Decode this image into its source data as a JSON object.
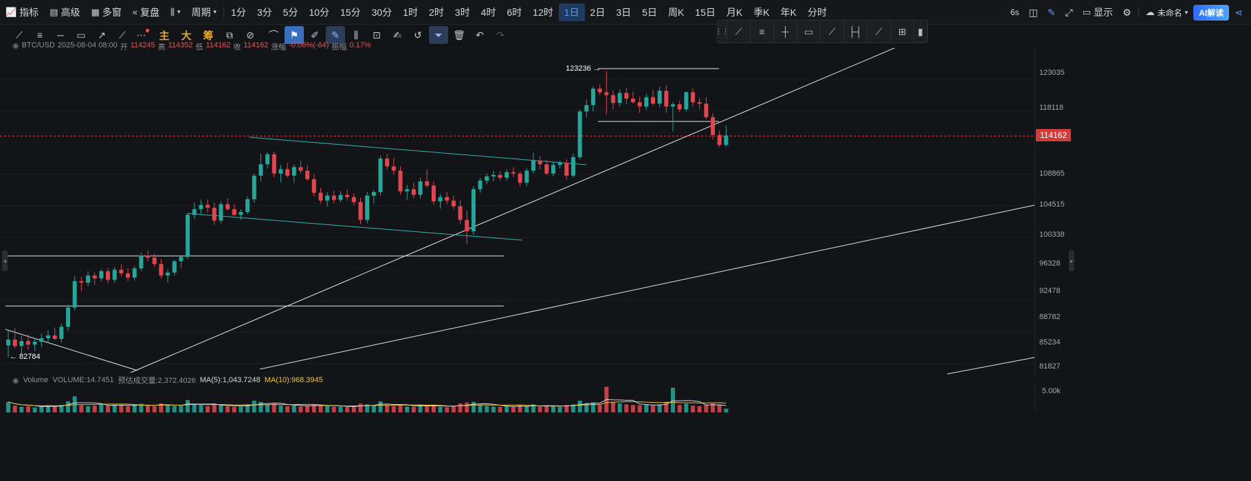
{
  "topbar": {
    "left_items": [
      {
        "name": "indicator-button",
        "icon": "chart-icon",
        "label": "指标"
      },
      {
        "name": "advanced-button",
        "icon": "calendar-icon",
        "label": "高级"
      },
      {
        "name": "multiwindow-button",
        "icon": "grid-icon",
        "label": "多窗"
      },
      {
        "name": "replay-button",
        "icon": "rewind-icon",
        "label": "复盘"
      },
      {
        "name": "chart-type-button",
        "icon": "candle-icon",
        "label": ""
      },
      {
        "name": "period-dropdown",
        "icon": "chevron-down-icon",
        "label": "周期"
      }
    ],
    "periods": [
      "1分",
      "3分",
      "5分",
      "10分",
      "15分",
      "30分",
      "1时",
      "2时",
      "3时",
      "4时",
      "6时",
      "12时",
      "1日",
      "2日",
      "3日",
      "5日",
      "周K",
      "15日",
      "月K",
      "季K",
      "年K",
      "分时"
    ],
    "active_period": "1日",
    "right": {
      "refresh": "6s",
      "display_label": "显示",
      "layout_name": "未命名",
      "ai_label": "AI解读"
    }
  },
  "drawing_tools": {
    "text_tools": [
      "主",
      "大",
      "筹"
    ]
  },
  "info": {
    "symbol": "BTC/USD",
    "datetime": "2025-08-04 08:00",
    "open_label": "开",
    "open": "114245",
    "high_label": "高",
    "high": "114352",
    "low_label": "低",
    "low": "114162",
    "close_label": "收",
    "close": "114162",
    "change_label": "涨幅",
    "change": "-0.06%(-64)",
    "amp_label": "振幅",
    "amp": "0.17%"
  },
  "price_axis": {
    "ticks": [
      "123035",
      "118118",
      "108865",
      "104515",
      "100338",
      "96328",
      "92478",
      "88782",
      "85234",
      "81827"
    ],
    "last_price": "114162"
  },
  "annotations": {
    "high_label": "123236",
    "low_label": "82784"
  },
  "volume": {
    "title": "Volume",
    "volume": "VOLUME:14.7451",
    "estimated": "预估成交量:2,372.4026",
    "ma5": "MA(5):1,043.7248",
    "ma10": "MA(10):968.3945",
    "axis_label": "5.00k"
  },
  "colors": {
    "up": "#26a69a",
    "down": "#e0464e",
    "accent": "#4c9cff",
    "channel": "#2fb7b7"
  },
  "chart_data": {
    "type": "candlestick",
    "title": "BTC/USD",
    "interval": "1日",
    "ylim": [
      80500,
      126500
    ],
    "candles": [
      [
        84800,
        86900,
        83100,
        85600
      ],
      [
        85600,
        87200,
        84400,
        84700
      ],
      [
        84700,
        86100,
        83600,
        85400
      ],
      [
        85400,
        86300,
        84200,
        84900
      ],
      [
        84900,
        85800,
        84000,
        85300
      ],
      [
        85300,
        86400,
        84600,
        85800
      ],
      [
        85800,
        86900,
        85100,
        86200
      ],
      [
        86200,
        87300,
        85500,
        85700
      ],
      [
        85700,
        87900,
        85200,
        87400
      ],
      [
        87400,
        90500,
        86800,
        90100
      ],
      [
        90100,
        94500,
        89700,
        93800
      ],
      [
        93800,
        94400,
        92400,
        93600
      ],
      [
        93600,
        95200,
        93100,
        94600
      ],
      [
        94600,
        95000,
        93300,
        94200
      ],
      [
        94200,
        95500,
        93800,
        95200
      ],
      [
        95200,
        95600,
        93500,
        94000
      ],
      [
        94000,
        95800,
        93600,
        95400
      ],
      [
        95400,
        96200,
        94500,
        94900
      ],
      [
        94900,
        95600,
        93800,
        94300
      ],
      [
        94300,
        95900,
        93900,
        95600
      ],
      [
        95600,
        97800,
        95200,
        97400
      ],
      [
        97400,
        98100,
        96600,
        97100
      ],
      [
        97100,
        97700,
        95800,
        96200
      ],
      [
        96200,
        96900,
        94200,
        94600
      ],
      [
        94600,
        95400,
        93600,
        95000
      ],
      [
        95000,
        96800,
        94600,
        96600
      ],
      [
        96600,
        97500,
        95700,
        97200
      ],
      [
        97200,
        103300,
        96900,
        103100
      ],
      [
        103100,
        104800,
        102500,
        103900
      ],
      [
        103900,
        105200,
        103300,
        104500
      ],
      [
        104500,
        105300,
        103400,
        104100
      ],
      [
        104100,
        104800,
        101700,
        102300
      ],
      [
        102300,
        105000,
        101900,
        104600
      ],
      [
        104600,
        105400,
        103700,
        103900
      ],
      [
        103900,
        104600,
        102900,
        103100
      ],
      [
        103100,
        103900,
        102400,
        103500
      ],
      [
        103500,
        105700,
        103200,
        105300
      ],
      [
        105300,
        108900,
        104800,
        108600
      ],
      [
        108600,
        111700,
        107800,
        110200
      ],
      [
        110200,
        111900,
        109600,
        111600
      ],
      [
        111600,
        112000,
        108400,
        108900
      ],
      [
        108900,
        110100,
        107700,
        109500
      ],
      [
        109500,
        110400,
        108300,
        108600
      ],
      [
        108600,
        110200,
        107600,
        109800
      ],
      [
        109800,
        110700,
        108900,
        109300
      ],
      [
        109300,
        110100,
        107900,
        108100
      ],
      [
        108100,
        108800,
        105700,
        106200
      ],
      [
        106200,
        106900,
        104700,
        105100
      ],
      [
        105100,
        106300,
        104300,
        105800
      ],
      [
        105800,
        106500,
        104700,
        105200
      ],
      [
        105200,
        106400,
        104900,
        105900
      ],
      [
        105900,
        106700,
        105100,
        105600
      ],
      [
        105600,
        106100,
        104400,
        104900
      ],
      [
        104900,
        105500,
        101800,
        102400
      ],
      [
        102400,
        106300,
        101900,
        105800
      ],
      [
        105800,
        106600,
        104700,
        106300
      ],
      [
        106300,
        111400,
        105800,
        111000
      ],
      [
        111000,
        111700,
        109400,
        109900
      ],
      [
        109900,
        111100,
        108700,
        109300
      ],
      [
        109300,
        109900,
        105900,
        106400
      ],
      [
        106400,
        107300,
        105200,
        106700
      ],
      [
        106700,
        107600,
        105400,
        105900
      ],
      [
        105900,
        108300,
        105400,
        107800
      ],
      [
        107800,
        109500,
        106900,
        107200
      ],
      [
        107200,
        107800,
        104500,
        105000
      ],
      [
        105000,
        106000,
        104000,
        105600
      ],
      [
        105600,
        106300,
        104600,
        105100
      ],
      [
        105100,
        105800,
        103900,
        104300
      ],
      [
        104300,
        105100,
        101800,
        102400
      ],
      [
        102400,
        103700,
        99000,
        100800
      ],
      [
        100800,
        107100,
        100300,
        106700
      ],
      [
        106700,
        108300,
        106200,
        107900
      ],
      [
        107900,
        108900,
        107400,
        108500
      ],
      [
        108500,
        109300,
        107800,
        108700
      ],
      [
        108700,
        109200,
        107900,
        108300
      ],
      [
        108300,
        109500,
        107900,
        109100
      ],
      [
        109100,
        109800,
        108400,
        108900
      ],
      [
        108900,
        109200,
        107100,
        107600
      ],
      [
        107600,
        109600,
        107100,
        109300
      ],
      [
        109300,
        111800,
        108900,
        110700
      ],
      [
        110700,
        111300,
        109500,
        110200
      ],
      [
        110200,
        110800,
        108700,
        108900
      ],
      [
        108900,
        110600,
        108500,
        110100
      ],
      [
        110100,
        110700,
        109600,
        110400
      ],
      [
        110400,
        110900,
        108100,
        108600
      ],
      [
        108600,
        111700,
        108300,
        111200
      ],
      [
        111200,
        117900,
        110900,
        117600
      ],
      [
        117600,
        119300,
        116800,
        118500
      ],
      [
        118500,
        121100,
        117600,
        120800
      ],
      [
        120800,
        121400,
        119900,
        120300
      ],
      [
        120300,
        123236,
        117200,
        119900
      ],
      [
        119900,
        120600,
        117900,
        118800
      ],
      [
        118800,
        120700,
        118300,
        120200
      ],
      [
        120200,
        120900,
        118600,
        119400
      ],
      [
        119400,
        120400,
        118700,
        118900
      ],
      [
        118900,
        119700,
        117400,
        118300
      ],
      [
        118300,
        120100,
        117800,
        119600
      ],
      [
        119600,
        120600,
        118400,
        118700
      ],
      [
        118700,
        121100,
        118200,
        120500
      ],
      [
        120500,
        121300,
        117400,
        118300
      ],
      [
        118300,
        118900,
        114800,
        118600
      ],
      [
        118600,
        119100,
        117500,
        117900
      ],
      [
        117900,
        120400,
        117600,
        120300
      ],
      [
        120300,
        120800,
        118300,
        118900
      ],
      [
        118900,
        119500,
        117900,
        118700
      ],
      [
        118700,
        119600,
        116500,
        116800
      ],
      [
        116800,
        117300,
        113700,
        114300
      ],
      [
        114300,
        114900,
        112600,
        112900
      ],
      [
        112900,
        115600,
        112700,
        114245
      ]
    ],
    "volumes": [
      3.4,
      2.2,
      1.8,
      2.0,
      1.6,
      1.9,
      2.3,
      2.0,
      2.4,
      3.6,
      5.2,
      2.3,
      2.0,
      2.2,
      2.6,
      2.1,
      2.5,
      2.3,
      2.0,
      2.4,
      2.8,
      2.2,
      2.0,
      2.9,
      2.4,
      2.1,
      2.2,
      4.0,
      2.8,
      2.4,
      2.0,
      2.5,
      2.3,
      2.0,
      1.8,
      1.9,
      2.6,
      3.8,
      3.4,
      2.5,
      2.8,
      2.2,
      2.0,
      2.4,
      1.9,
      2.1,
      2.6,
      2.4,
      2.0,
      1.8,
      1.9,
      1.8,
      2.0,
      2.8,
      2.6,
      2.2,
      3.6,
      2.4,
      2.0,
      2.6,
      1.9,
      1.8,
      2.3,
      2.0,
      2.5,
      1.8,
      1.7,
      2.0,
      2.9,
      3.2,
      3.4,
      2.4,
      2.1,
      1.9,
      1.8,
      2.0,
      1.8,
      2.3,
      2.0,
      2.6,
      1.9,
      2.2,
      2.0,
      1.8,
      2.4,
      2.6,
      3.8,
      3.0,
      3.2,
      2.4,
      8.3,
      3.4,
      2.9,
      2.6,
      2.4,
      2.3,
      2.5,
      2.2,
      2.6,
      3.4,
      8.0,
      2.4,
      2.8,
      2.2,
      2.0,
      2.4,
      2.9,
      2.6,
      1.2
    ]
  }
}
